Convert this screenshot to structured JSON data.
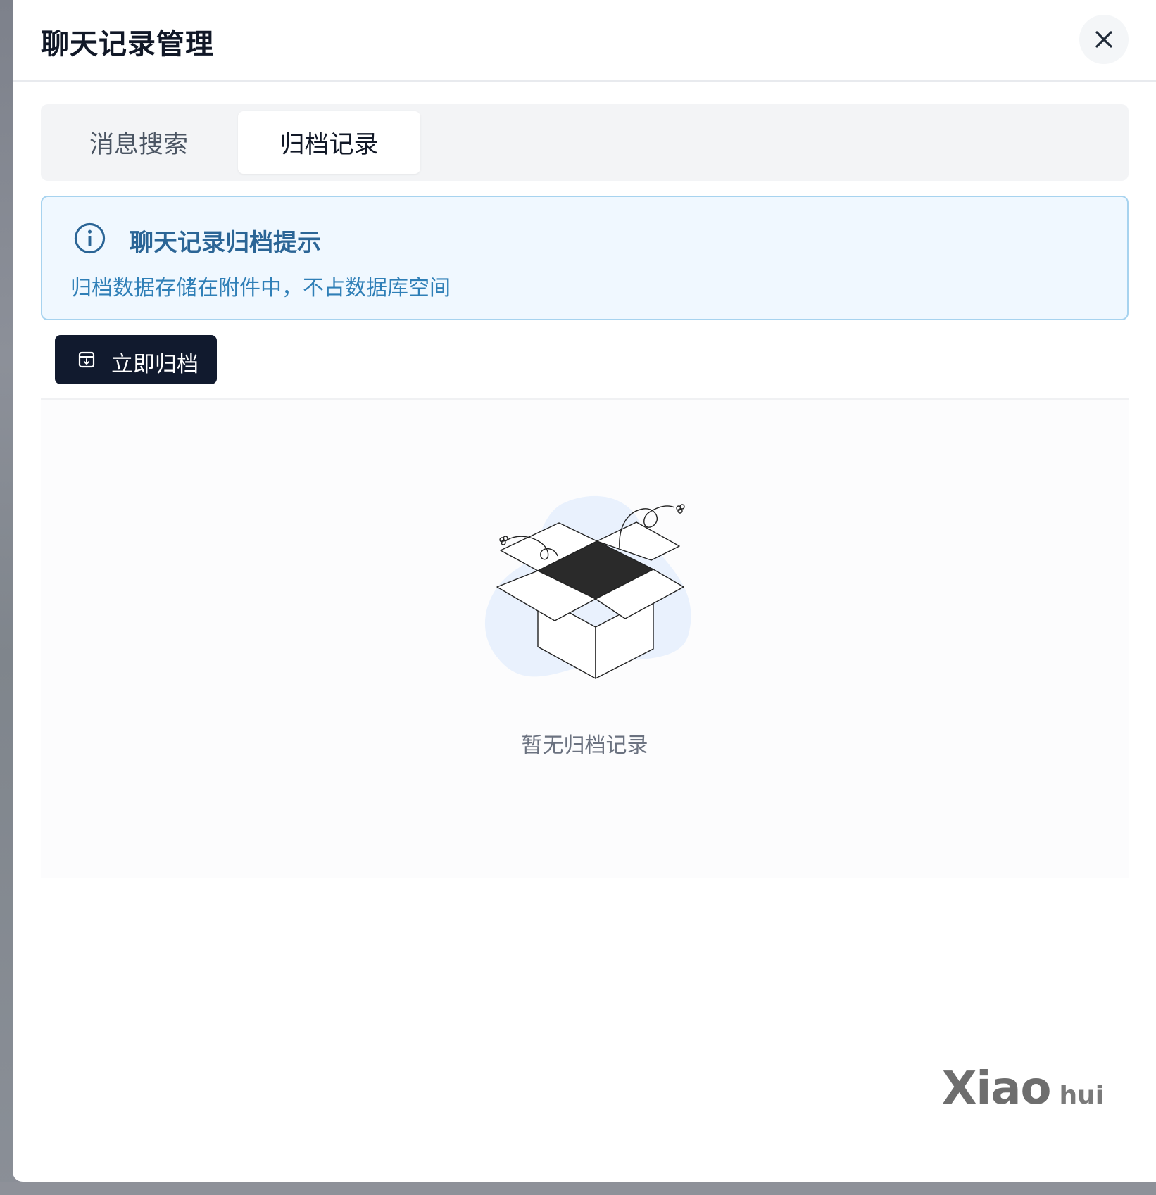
{
  "dialog": {
    "title": "聊天记录管理",
    "close_icon": "close-icon"
  },
  "tabs": [
    {
      "label": "消息搜索",
      "active": false
    },
    {
      "label": "归档记录",
      "active": true
    }
  ],
  "alert": {
    "icon": "info-icon",
    "title": "聊天记录归档提示",
    "description": "归档数据存储在附件中，不占数据库空间",
    "accent_color": "#2b6596"
  },
  "actions": {
    "archive_now_label": "立即归档",
    "archive_icon": "archive-icon"
  },
  "empty_state": {
    "illustration": "empty-box-illustration",
    "message": "暂无归档记录"
  },
  "watermark": {
    "main": "Xiao",
    "sub": "hui"
  }
}
